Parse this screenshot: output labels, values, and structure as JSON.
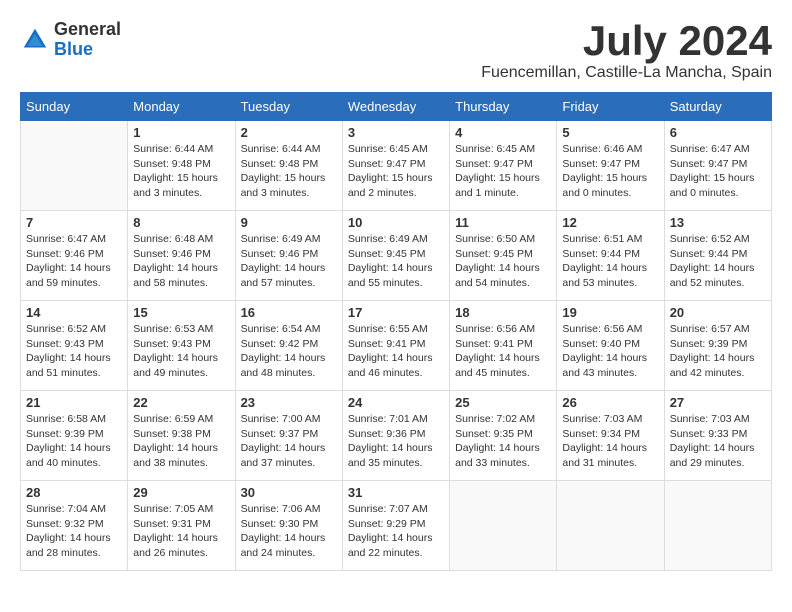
{
  "header": {
    "logo_general": "General",
    "logo_blue": "Blue",
    "month_title": "July 2024",
    "location": "Fuencemillan, Castille-La Mancha, Spain"
  },
  "weekdays": [
    "Sunday",
    "Monday",
    "Tuesday",
    "Wednesday",
    "Thursday",
    "Friday",
    "Saturday"
  ],
  "weeks": [
    [
      {
        "day": "",
        "sunrise": "",
        "sunset": "",
        "daylight": ""
      },
      {
        "day": "1",
        "sunrise": "Sunrise: 6:44 AM",
        "sunset": "Sunset: 9:48 PM",
        "daylight": "Daylight: 15 hours and 3 minutes."
      },
      {
        "day": "2",
        "sunrise": "Sunrise: 6:44 AM",
        "sunset": "Sunset: 9:48 PM",
        "daylight": "Daylight: 15 hours and 3 minutes."
      },
      {
        "day": "3",
        "sunrise": "Sunrise: 6:45 AM",
        "sunset": "Sunset: 9:47 PM",
        "daylight": "Daylight: 15 hours and 2 minutes."
      },
      {
        "day": "4",
        "sunrise": "Sunrise: 6:45 AM",
        "sunset": "Sunset: 9:47 PM",
        "daylight": "Daylight: 15 hours and 1 minute."
      },
      {
        "day": "5",
        "sunrise": "Sunrise: 6:46 AM",
        "sunset": "Sunset: 9:47 PM",
        "daylight": "Daylight: 15 hours and 0 minutes."
      },
      {
        "day": "6",
        "sunrise": "Sunrise: 6:47 AM",
        "sunset": "Sunset: 9:47 PM",
        "daylight": "Daylight: 15 hours and 0 minutes."
      }
    ],
    [
      {
        "day": "7",
        "sunrise": "Sunrise: 6:47 AM",
        "sunset": "Sunset: 9:46 PM",
        "daylight": "Daylight: 14 hours and 59 minutes."
      },
      {
        "day": "8",
        "sunrise": "Sunrise: 6:48 AM",
        "sunset": "Sunset: 9:46 PM",
        "daylight": "Daylight: 14 hours and 58 minutes."
      },
      {
        "day": "9",
        "sunrise": "Sunrise: 6:49 AM",
        "sunset": "Sunset: 9:46 PM",
        "daylight": "Daylight: 14 hours and 57 minutes."
      },
      {
        "day": "10",
        "sunrise": "Sunrise: 6:49 AM",
        "sunset": "Sunset: 9:45 PM",
        "daylight": "Daylight: 14 hours and 55 minutes."
      },
      {
        "day": "11",
        "sunrise": "Sunrise: 6:50 AM",
        "sunset": "Sunset: 9:45 PM",
        "daylight": "Daylight: 14 hours and 54 minutes."
      },
      {
        "day": "12",
        "sunrise": "Sunrise: 6:51 AM",
        "sunset": "Sunset: 9:44 PM",
        "daylight": "Daylight: 14 hours and 53 minutes."
      },
      {
        "day": "13",
        "sunrise": "Sunrise: 6:52 AM",
        "sunset": "Sunset: 9:44 PM",
        "daylight": "Daylight: 14 hours and 52 minutes."
      }
    ],
    [
      {
        "day": "14",
        "sunrise": "Sunrise: 6:52 AM",
        "sunset": "Sunset: 9:43 PM",
        "daylight": "Daylight: 14 hours and 51 minutes."
      },
      {
        "day": "15",
        "sunrise": "Sunrise: 6:53 AM",
        "sunset": "Sunset: 9:43 PM",
        "daylight": "Daylight: 14 hours and 49 minutes."
      },
      {
        "day": "16",
        "sunrise": "Sunrise: 6:54 AM",
        "sunset": "Sunset: 9:42 PM",
        "daylight": "Daylight: 14 hours and 48 minutes."
      },
      {
        "day": "17",
        "sunrise": "Sunrise: 6:55 AM",
        "sunset": "Sunset: 9:41 PM",
        "daylight": "Daylight: 14 hours and 46 minutes."
      },
      {
        "day": "18",
        "sunrise": "Sunrise: 6:56 AM",
        "sunset": "Sunset: 9:41 PM",
        "daylight": "Daylight: 14 hours and 45 minutes."
      },
      {
        "day": "19",
        "sunrise": "Sunrise: 6:56 AM",
        "sunset": "Sunset: 9:40 PM",
        "daylight": "Daylight: 14 hours and 43 minutes."
      },
      {
        "day": "20",
        "sunrise": "Sunrise: 6:57 AM",
        "sunset": "Sunset: 9:39 PM",
        "daylight": "Daylight: 14 hours and 42 minutes."
      }
    ],
    [
      {
        "day": "21",
        "sunrise": "Sunrise: 6:58 AM",
        "sunset": "Sunset: 9:39 PM",
        "daylight": "Daylight: 14 hours and 40 minutes."
      },
      {
        "day": "22",
        "sunrise": "Sunrise: 6:59 AM",
        "sunset": "Sunset: 9:38 PM",
        "daylight": "Daylight: 14 hours and 38 minutes."
      },
      {
        "day": "23",
        "sunrise": "Sunrise: 7:00 AM",
        "sunset": "Sunset: 9:37 PM",
        "daylight": "Daylight: 14 hours and 37 minutes."
      },
      {
        "day": "24",
        "sunrise": "Sunrise: 7:01 AM",
        "sunset": "Sunset: 9:36 PM",
        "daylight": "Daylight: 14 hours and 35 minutes."
      },
      {
        "day": "25",
        "sunrise": "Sunrise: 7:02 AM",
        "sunset": "Sunset: 9:35 PM",
        "daylight": "Daylight: 14 hours and 33 minutes."
      },
      {
        "day": "26",
        "sunrise": "Sunrise: 7:03 AM",
        "sunset": "Sunset: 9:34 PM",
        "daylight": "Daylight: 14 hours and 31 minutes."
      },
      {
        "day": "27",
        "sunrise": "Sunrise: 7:03 AM",
        "sunset": "Sunset: 9:33 PM",
        "daylight": "Daylight: 14 hours and 29 minutes."
      }
    ],
    [
      {
        "day": "28",
        "sunrise": "Sunrise: 7:04 AM",
        "sunset": "Sunset: 9:32 PM",
        "daylight": "Daylight: 14 hours and 28 minutes."
      },
      {
        "day": "29",
        "sunrise": "Sunrise: 7:05 AM",
        "sunset": "Sunset: 9:31 PM",
        "daylight": "Daylight: 14 hours and 26 minutes."
      },
      {
        "day": "30",
        "sunrise": "Sunrise: 7:06 AM",
        "sunset": "Sunset: 9:30 PM",
        "daylight": "Daylight: 14 hours and 24 minutes."
      },
      {
        "day": "31",
        "sunrise": "Sunrise: 7:07 AM",
        "sunset": "Sunset: 9:29 PM",
        "daylight": "Daylight: 14 hours and 22 minutes."
      },
      {
        "day": "",
        "sunrise": "",
        "sunset": "",
        "daylight": ""
      },
      {
        "day": "",
        "sunrise": "",
        "sunset": "",
        "daylight": ""
      },
      {
        "day": "",
        "sunrise": "",
        "sunset": "",
        "daylight": ""
      }
    ]
  ]
}
